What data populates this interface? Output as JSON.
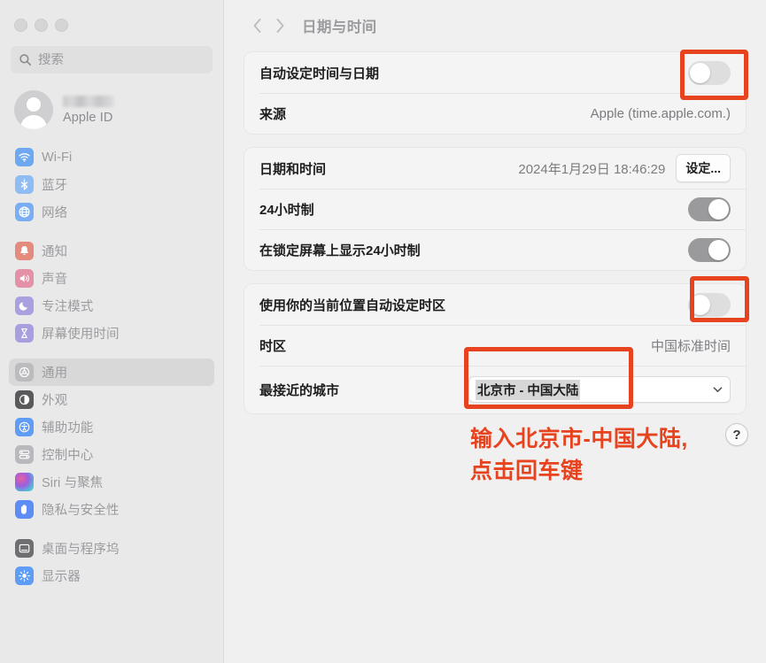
{
  "window": {
    "traffic_lights": [
      "close",
      "minimize",
      "zoom"
    ]
  },
  "sidebar": {
    "search": {
      "placeholder": "搜索",
      "value": "",
      "icon": "search-icon"
    },
    "account": {
      "name_redacted": "",
      "subtitle": "Apple ID",
      "avatar_icon": "person-avatar-icon"
    },
    "groups": [
      {
        "items": [
          {
            "label": "Wi-Fi",
            "icon": "wifi-icon",
            "selected": false
          },
          {
            "label": "蓝牙",
            "icon": "bluetooth-icon",
            "selected": false
          },
          {
            "label": "网络",
            "icon": "globe-icon",
            "selected": false
          }
        ]
      },
      {
        "items": [
          {
            "label": "通知",
            "icon": "bell-icon",
            "selected": false
          },
          {
            "label": "声音",
            "icon": "speaker-icon",
            "selected": false
          },
          {
            "label": "专注模式",
            "icon": "moon-icon",
            "selected": false
          },
          {
            "label": "屏幕使用时间",
            "icon": "hourglass-icon",
            "selected": false
          }
        ]
      },
      {
        "items": [
          {
            "label": "通用",
            "icon": "gear-icon",
            "selected": true
          },
          {
            "label": "外观",
            "icon": "appearance-icon",
            "selected": false
          },
          {
            "label": "辅助功能",
            "icon": "accessibility-icon",
            "selected": false
          },
          {
            "label": "控制中心",
            "icon": "control-center-icon",
            "selected": false
          },
          {
            "label": "Siri 与聚焦",
            "icon": "siri-icon",
            "selected": false
          },
          {
            "label": "隐私与安全性",
            "icon": "hand-icon",
            "selected": false
          }
        ]
      },
      {
        "items": [
          {
            "label": "桌面与程序坞",
            "icon": "desktop-dock-icon",
            "selected": false
          },
          {
            "label": "显示器",
            "icon": "display-brightness-icon",
            "selected": false
          }
        ]
      }
    ]
  },
  "toolbar": {
    "back_icon": "chevron-left-icon",
    "forward_icon": "chevron-right-icon",
    "title": "日期与时间"
  },
  "cards": {
    "auto_time": {
      "toggle_label": "自动设定时间与日期",
      "toggle_state": "off",
      "source_label": "来源",
      "source_value": "Apple (time.apple.com.)"
    },
    "datetime": {
      "datetime_label": "日期和时间",
      "datetime_value": "2024年1月29日 18:46:29",
      "set_button": "设定...",
      "hour24_label": "24小时制",
      "hour24_state": "on",
      "lockscreen_label": "在锁定屏幕上显示24小时制",
      "lockscreen_state": "on"
    },
    "timezone": {
      "auto_tz_label": "使用你的当前位置自动设定时区",
      "auto_tz_state": "off",
      "tz_label": "时区",
      "tz_value": "中国标准时间",
      "city_label": "最接近的城市",
      "city_value": "北京市 - 中国大陆",
      "city_arrow_icon": "chevron-down-icon"
    }
  },
  "annotations": {
    "accent_color": "#e8431f",
    "line1": "输入北京市-中国大陆,",
    "line2": "点击回车键",
    "help_button": "?",
    "highlight_boxes": [
      "auto-time-toggle",
      "auto-timezone-toggle",
      "closest-city-combo"
    ]
  }
}
